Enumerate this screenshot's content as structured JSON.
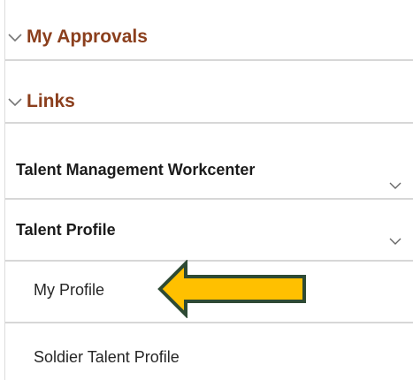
{
  "sections": [
    {
      "label": "My Approvals",
      "icon": "chevron-down-icon"
    },
    {
      "label": "Links",
      "icon": "chevron-down-icon"
    }
  ],
  "menu": [
    {
      "label": "Talent Management Workcenter",
      "level": 1,
      "icon": "chevron-down-icon"
    },
    {
      "label": "Talent Profile",
      "level": 1,
      "icon": "chevron-down-icon"
    },
    {
      "label": "My Profile",
      "level": 2
    },
    {
      "label": "Soldier Talent Profile",
      "level": 2
    }
  ],
  "annotation": {
    "icon": "arrow-left-icon",
    "fill_color": "#FFC000",
    "outline_color": "#2E4A34"
  },
  "colors": {
    "section_header": "#8B3F1D",
    "divider": "#D7D7D7"
  }
}
